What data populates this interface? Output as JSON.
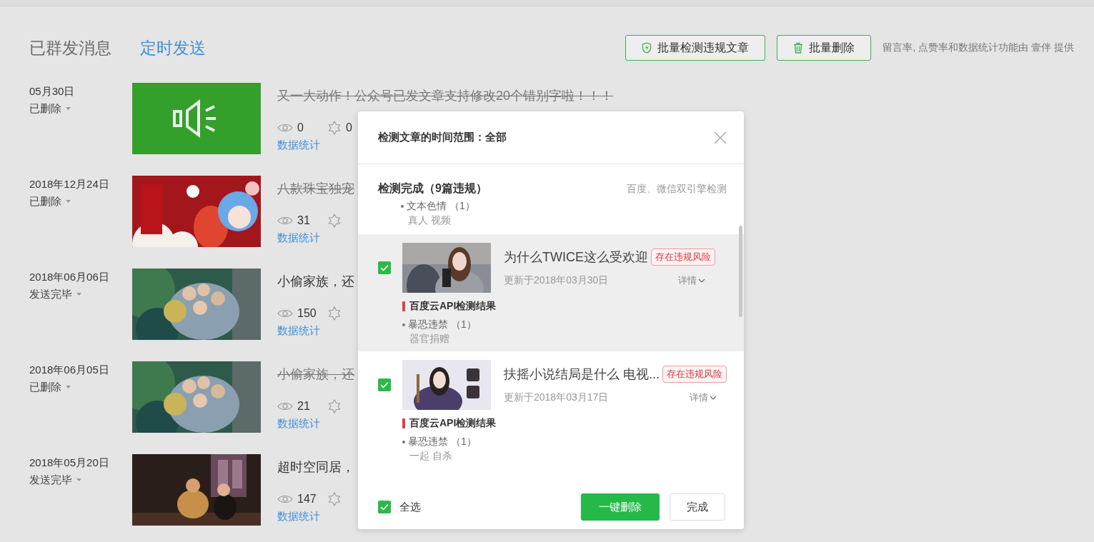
{
  "tabs": [
    {
      "label": "已群发消息",
      "selected": true
    },
    {
      "label": "定时发送",
      "selected": false
    }
  ],
  "toolbar": {
    "check_button": "批量检测违规文章",
    "delete_button": "批量删除",
    "note": "留言率, 点赞率和数据统计功能由 壹伴 提供"
  },
  "messages": [
    {
      "date": "05月30日",
      "status": "已删除",
      "deleted": true,
      "thumbnail": {
        "kind": "speaker"
      },
      "title": "又一大动作！公众号已发文章支持修改20个错别字啦！！！",
      "views": "0",
      "likes": "0",
      "stats_link": "数据统计"
    },
    {
      "date": "2018年12月24日",
      "status": "已删除",
      "deleted": true,
      "title": "八款珠宝独宠",
      "views": "31",
      "stats_link": "数据统计"
    },
    {
      "date": "2018年06月06日",
      "status": "发送完毕",
      "deleted": false,
      "title": "小偷家族，还",
      "views": "150",
      "stats_link": "数据统计"
    },
    {
      "date": "2018年06月05日",
      "status": "已删除",
      "deleted": true,
      "title": "小偷家族，还",
      "views": "21",
      "stats_link": "数据统计"
    },
    {
      "date": "2018年05月20日",
      "status": "发送完毕",
      "deleted": false,
      "title": "超时空同居，",
      "views": "147",
      "stats_link": "数据统计"
    }
  ],
  "dialog": {
    "title": "检测文章的时间范围：全部",
    "summary": "检测完成（9篇违规）",
    "engines": "百度、微信双引擎检测",
    "summary_items": [
      {
        "label": "文本色情 （1）",
        "keywords": "真人 视频"
      }
    ],
    "articles": [
      {
        "selected": true,
        "checked": true,
        "title": "为什么TWICE这么受欢迎",
        "risk": "存在违规风险",
        "updated": "更新于2018年03月30日",
        "details": "详情",
        "result_title": "百度云API检测结果",
        "violation": "暴恐违禁 （1）",
        "keywords": "器官捐赠"
      },
      {
        "selected": false,
        "checked": true,
        "title": "扶摇小说结局是什么 电视...",
        "risk": "存在违规风险",
        "updated": "更新于2018年03月17日",
        "details": "详情",
        "result_title": "百度云API检测结果",
        "violation": "暴恐违禁 （1）",
        "keywords": "一起 自杀"
      }
    ],
    "select_all": {
      "label": "全选",
      "checked": true
    },
    "delete_button": "一键删除",
    "done_button": "完成"
  }
}
